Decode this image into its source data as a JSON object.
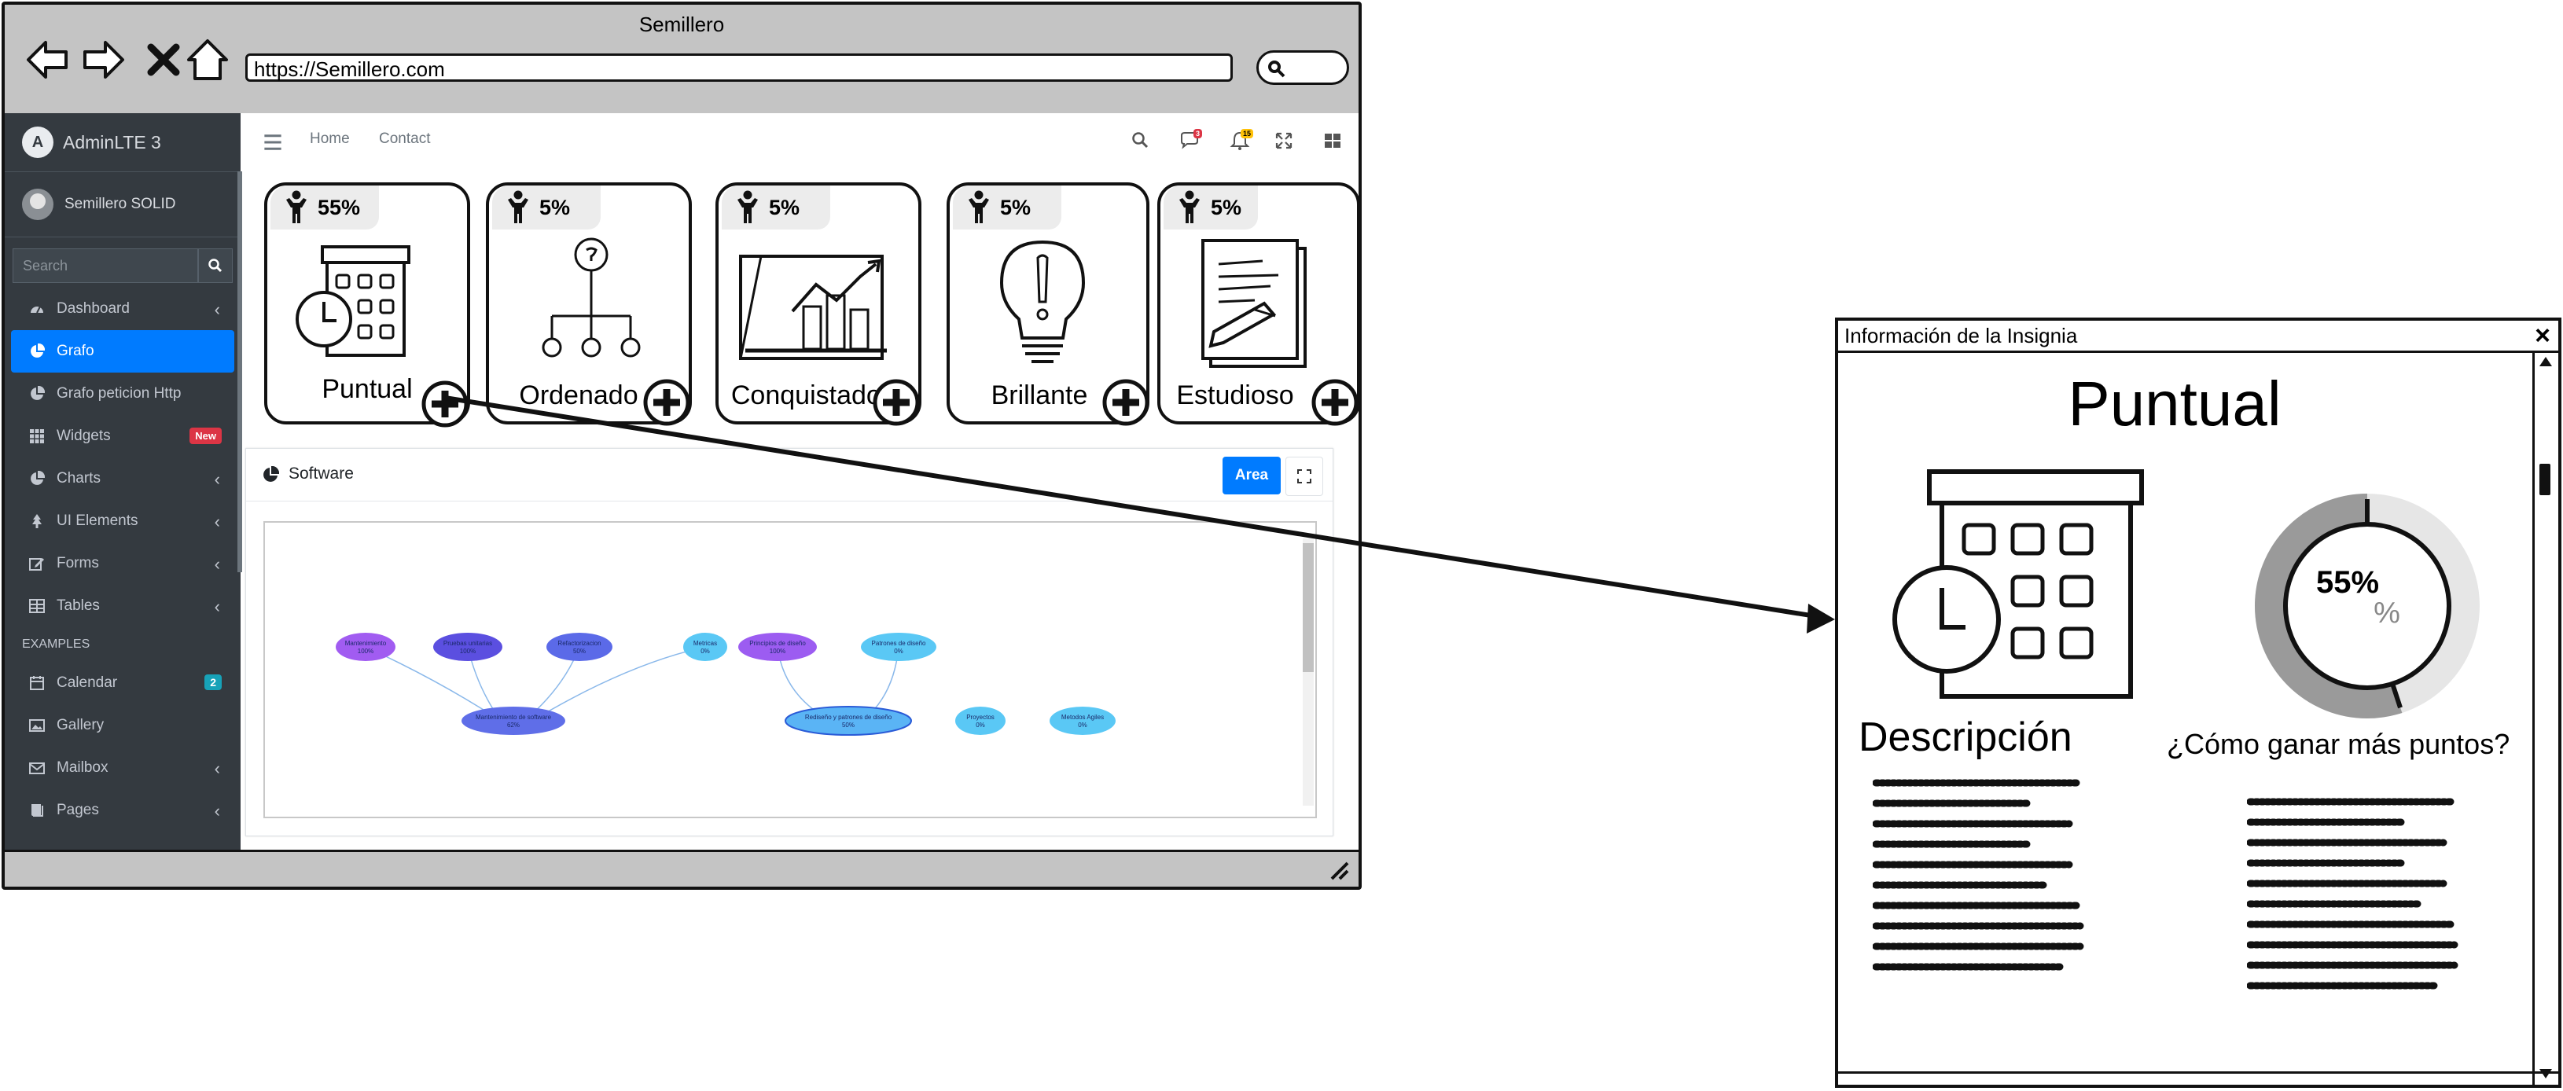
{
  "browser": {
    "title": "Semillero",
    "url": "https://Semillero.com"
  },
  "sidebar": {
    "brand": "AdminLTE 3",
    "brand_logo": "A",
    "user": "Semillero SOLID",
    "search_placeholder": "Search",
    "items": [
      {
        "label": "Dashboard",
        "icon": "dashboard-icon",
        "chevron": true
      },
      {
        "label": "Grafo",
        "icon": "chart-pie-icon",
        "active": true
      },
      {
        "label": "Grafo peticion Http",
        "icon": "chart-pie-icon"
      },
      {
        "label": "Widgets",
        "icon": "grid-icon",
        "badge": "New"
      },
      {
        "label": "Charts",
        "icon": "chart-pie-icon",
        "chevron": true
      },
      {
        "label": "UI Elements",
        "icon": "tree-icon",
        "chevron": true
      },
      {
        "label": "Forms",
        "icon": "edit-icon",
        "chevron": true
      },
      {
        "label": "Tables",
        "icon": "table-icon",
        "chevron": true
      }
    ],
    "examples_header": "EXAMPLES",
    "examples": [
      {
        "label": "Calendar",
        "icon": "calendar-icon",
        "badge": "2"
      },
      {
        "label": "Gallery",
        "icon": "image-icon"
      },
      {
        "label": "Mailbox",
        "icon": "envelope-icon",
        "chevron": true
      },
      {
        "label": "Pages",
        "icon": "book-icon",
        "chevron": true
      }
    ]
  },
  "topnav": {
    "home": "Home",
    "contact": "Contact",
    "messages_badge": "3",
    "notifications_badge": "15"
  },
  "badges": [
    {
      "percent": "55%",
      "name": "Puntual",
      "icon": "calendar-clock-icon"
    },
    {
      "percent": "5%",
      "name": "Ordenado",
      "icon": "hierarchy-icon"
    },
    {
      "percent": "5%",
      "name": "Conquistador",
      "icon": "chart-growth-icon"
    },
    {
      "percent": "5%",
      "name": "Brillante",
      "icon": "lightbulb-icon"
    },
    {
      "percent": "5%",
      "name": "Estudioso",
      "icon": "document-pen-icon"
    }
  ],
  "software_card": {
    "title": "Software",
    "area_button": "Area"
  },
  "graph": {
    "nodes": [
      {
        "label": "Mantenimiento",
        "value": "100%",
        "color": "#a15cf1"
      },
      {
        "label": "Pruebas unitarias",
        "value": "100%",
        "color": "#5b4fe0"
      },
      {
        "label": "Refactorizacion",
        "value": "50%",
        "color": "#5b6ae8"
      },
      {
        "label": "Metricas",
        "value": "0%",
        "color": "#5ac8f5"
      },
      {
        "label": "Mantenimiento de software",
        "value": "62%",
        "color": "#5f6ee8"
      },
      {
        "label": "Principios de diseño",
        "value": "100%",
        "color": "#9c5cf1"
      },
      {
        "label": "Patrones de diseño",
        "value": "0%",
        "color": "#5ac8f5"
      },
      {
        "label": "Rediseño y patrones de diseño",
        "value": "50%",
        "color": "#5ab4f5"
      },
      {
        "label": "Proyectos",
        "value": "0%",
        "color": "#5ac8f5"
      },
      {
        "label": "Metodos Agiles",
        "value": "0%",
        "color": "#5ac8f5"
      }
    ]
  },
  "panel": {
    "title": "Información de la Insignia",
    "badge_name": "Puntual",
    "percent": "55%",
    "percent_value": 55,
    "percent_symbol": "%",
    "description_title": "Descripción",
    "how_title": "¿Cómo ganar más puntos?"
  }
}
